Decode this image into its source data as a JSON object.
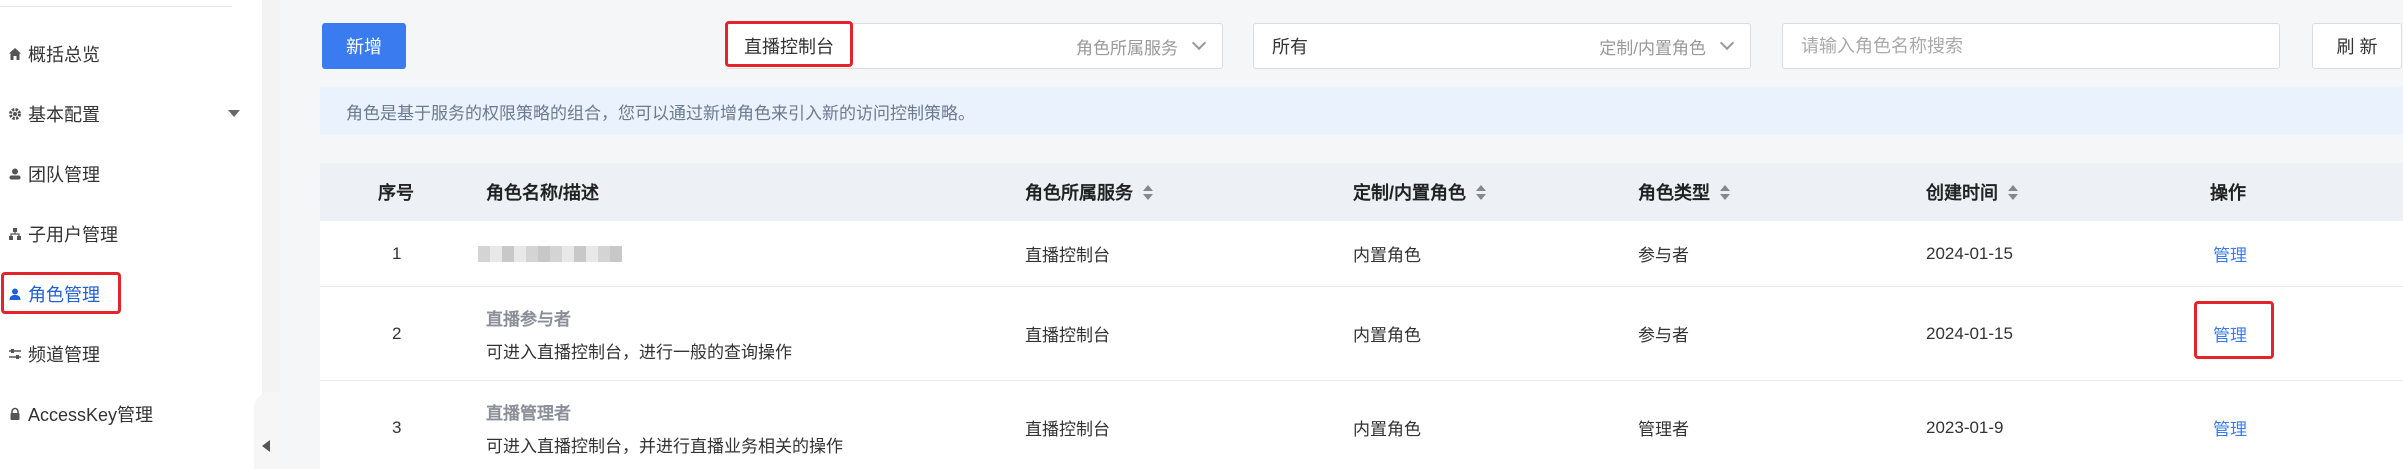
{
  "sidebar": {
    "items": [
      {
        "label": "概括总览",
        "icon": "home-icon"
      },
      {
        "label": "基本配置",
        "icon": "gear-icon"
      },
      {
        "label": "团队管理",
        "icon": "team-icon"
      },
      {
        "label": "子用户管理",
        "icon": "sitemap-icon"
      },
      {
        "label": "角色管理",
        "icon": "user-icon"
      },
      {
        "label": "频道管理",
        "icon": "sliders-icon"
      },
      {
        "label": "AccessKey管理",
        "icon": "lock-icon"
      }
    ]
  },
  "toolbar": {
    "add_label": "新增",
    "service_select": {
      "value": "直播控制台",
      "label": "角色所属服务"
    },
    "type_select": {
      "value": "所有",
      "label": "定制/内置角色"
    },
    "search_placeholder": "请输入角色名称搜索",
    "refresh_label": "刷 新"
  },
  "notice": "角色是基于服务的权限策略的组合，您可以通过新增角色来引入新的访问控制策略。",
  "table": {
    "columns": [
      "序号",
      "角色名称/描述",
      "角色所属服务",
      "定制/内置角色",
      "角色类型",
      "创建时间",
      "操作"
    ],
    "rows": [
      {
        "index": "1",
        "title": "",
        "desc": "",
        "service": "直播控制台",
        "builtin": "内置角色",
        "type": "参与者",
        "created": "2024-01-15",
        "action": "管理"
      },
      {
        "index": "2",
        "title": "直播参与者",
        "desc": "可进入直播控制台，进行一般的查询操作",
        "service": "直播控制台",
        "builtin": "内置角色",
        "type": "参与者",
        "created": "2024-01-15",
        "action": "管理"
      },
      {
        "index": "3",
        "title": "直播管理者",
        "desc": "可进入直播控制台，并进行直播业务相关的操作",
        "service": "直播控制台",
        "builtin": "内置角色",
        "type": "管理者",
        "created": "2023-01-9",
        "action": "管理"
      }
    ]
  },
  "colors": {
    "accent": "#3a7cf0",
    "highlight": "#e3242b",
    "notice_bg": "#eaf2fd"
  }
}
